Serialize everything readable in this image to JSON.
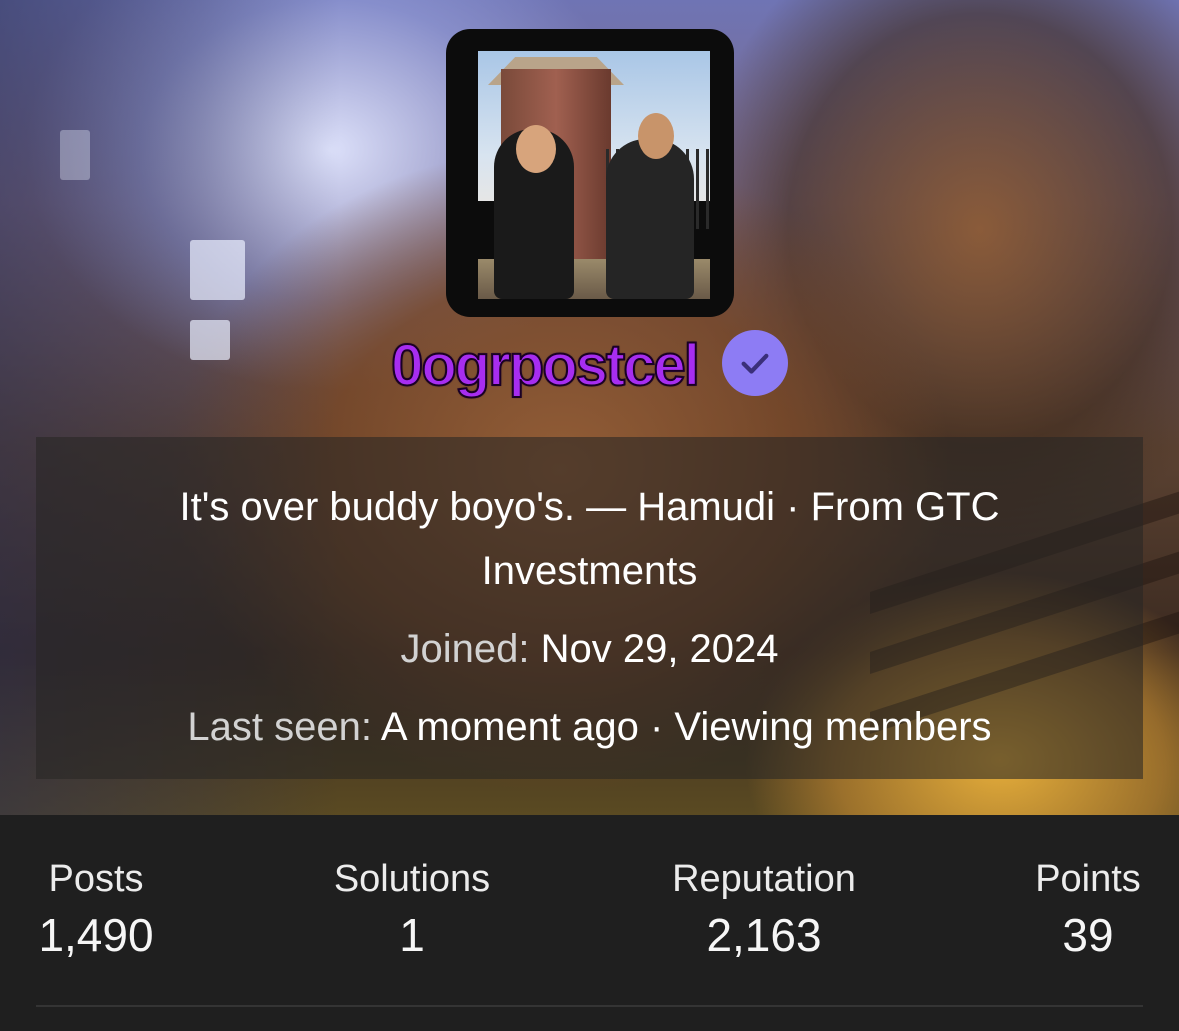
{
  "profile": {
    "username": "0ogrpostcel",
    "status_text": "It's over buddy boyo's. — Hamudi · From GTC Investments",
    "joined_label": "Joined:",
    "joined_value": "Nov 29, 2024",
    "last_seen_label": "Last seen:",
    "last_seen_value": "A moment ago · Viewing members",
    "verified_icon": "checkmark-badge-icon",
    "username_color": "#a72df0",
    "verified_color": "#8d7cf4"
  },
  "stats": [
    {
      "label": "Posts",
      "value": "1,490"
    },
    {
      "label": "Solutions",
      "value": "1"
    },
    {
      "label": "Reputation",
      "value": "2,163"
    },
    {
      "label": "Points",
      "value": "39"
    }
  ]
}
